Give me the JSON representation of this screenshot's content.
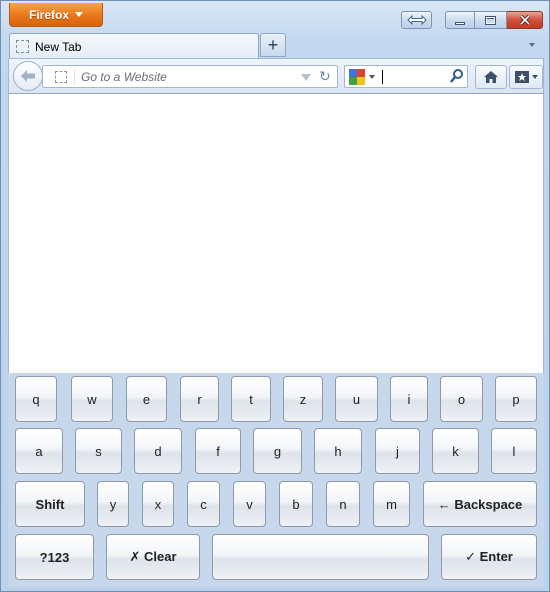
{
  "browser": {
    "menu_button_label": "Firefox",
    "tab_title": "New Tab",
    "new_tab_label": "+",
    "url_placeholder": "Go to a Website",
    "search_value": ""
  },
  "keyboard": {
    "row1": [
      "q",
      "w",
      "e",
      "r",
      "t",
      "z",
      "u",
      "i",
      "o",
      "p"
    ],
    "row2": [
      "a",
      "s",
      "d",
      "f",
      "g",
      "h",
      "j",
      "k",
      "l"
    ],
    "row3": [
      "y",
      "x",
      "c",
      "v",
      "b",
      "n",
      "m"
    ],
    "shift_label": "Shift",
    "backspace_label": "← Backspace",
    "symbols_label": "?123",
    "clear_label": "✗ Clear",
    "space_label": "",
    "enter_label": "✓ Enter"
  }
}
